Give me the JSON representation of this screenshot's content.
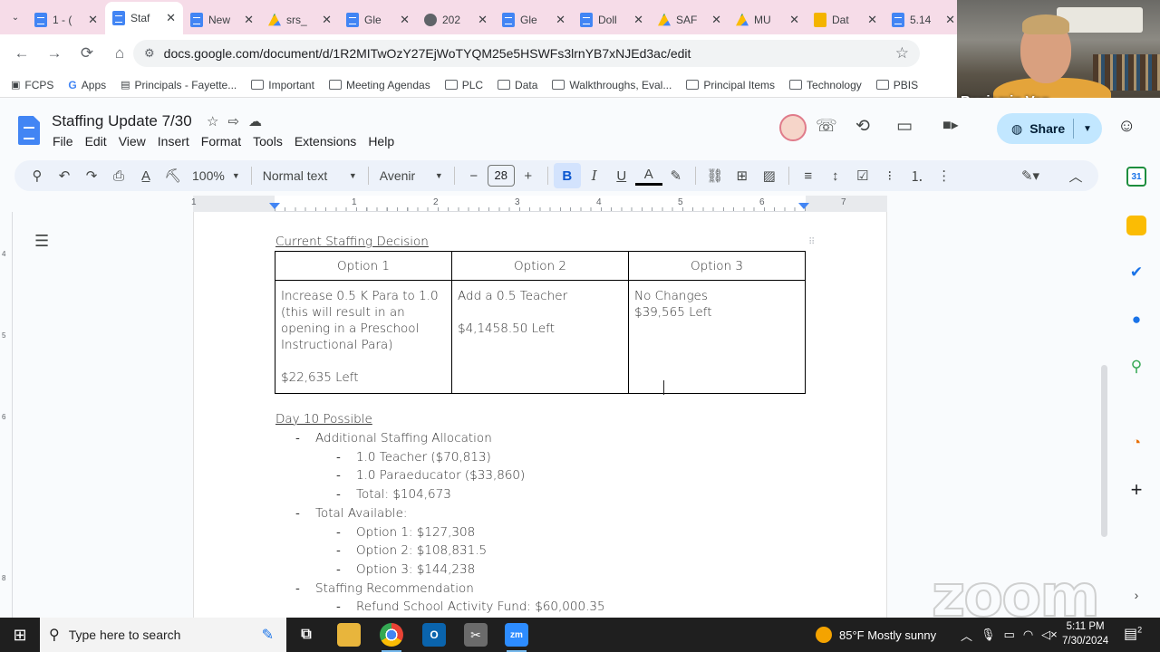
{
  "browser": {
    "tabs": [
      {
        "label": "1 - (",
        "icon": "docs-icon"
      },
      {
        "label": "Staf",
        "icon": "docs-icon",
        "active": true
      },
      {
        "label": "New",
        "icon": "docs-icon"
      },
      {
        "label": "srs_",
        "icon": "drive-icon"
      },
      {
        "label": "Gle",
        "icon": "docs-icon"
      },
      {
        "label": "202",
        "icon": "globe-icon"
      },
      {
        "label": "Gle",
        "icon": "docs-icon"
      },
      {
        "label": "Doll",
        "icon": "docs-icon"
      },
      {
        "label": "SAF",
        "icon": "drive-icon"
      },
      {
        "label": "MU",
        "icon": "drive-icon"
      },
      {
        "label": "Dat",
        "icon": "slides-icon"
      },
      {
        "label": "5.14",
        "icon": "docs-icon"
      }
    ],
    "url": "docs.google.com/document/d/1R2MITwOzY27EjWoTYQM25e5HSWFs3lrnYB7xNJEd3ac/edit",
    "bookmarks": [
      "FCPS",
      "Apps",
      "Principals - Fayette...",
      "Important",
      "Meeting Agendas",
      "PLC",
      "Data",
      "Walkthroughs, Eval...",
      "Principal Items",
      "Technology",
      "PBIS"
    ]
  },
  "webcam": {
    "name": "Benjamin Van..."
  },
  "docs": {
    "title": "Staffing Update 7/30",
    "menu": [
      "File",
      "Edit",
      "View",
      "Insert",
      "Format",
      "Tools",
      "Extensions",
      "Help"
    ],
    "share_label": "Share",
    "toolbar": {
      "zoom": "100%",
      "style": "Normal text",
      "font": "Avenir",
      "font_size": "28"
    },
    "ruler_numbers": [
      "1",
      "1",
      "2",
      "3",
      "4",
      "5",
      "6",
      "7"
    ],
    "vruler_numbers": [
      "4",
      "5",
      "6",
      "8"
    ]
  },
  "document": {
    "heading1": "Current Staffing Decision",
    "table": {
      "headers": [
        "Option 1",
        "Option 2",
        "Option 3"
      ],
      "cells": [
        "Increase 0.5 K Para to 1.0\n(this will result in an\nopening in a Preschool\nInstructional Para)\n\n$22,635 Left",
        "Add a 0.5 Teacher\n\n$4,1458.50 Left",
        "No Changes\n$39,565 Left"
      ]
    },
    "heading2": "Day 10 Possible",
    "bullet_marker": "-",
    "list": [
      {
        "text": "Additional Staffing Allocation",
        "level": 1
      },
      {
        "text": "1.0 Teacher ($70,813)",
        "level": 2
      },
      {
        "text": "1.0 Paraeducator ($33,860)",
        "level": 2
      },
      {
        "text": "Total: $104,673",
        "level": 2
      },
      {
        "text": "Total Available:",
        "level": 1
      },
      {
        "text": "Option 1: $127,308",
        "level": 2
      },
      {
        "text": "Option 2: $108,831.5",
        "level": 2
      },
      {
        "text": "Option 3: $144,238",
        "level": 2
      },
      {
        "text": "Staffing Recommendation",
        "level": 1
      },
      {
        "text": "Refund School Activity Fund: $60,000.35",
        "level": 2
      }
    ]
  },
  "watermark": "zoom",
  "taskbar": {
    "search_placeholder": "Type here to search",
    "weather": "85°F  Mostly sunny",
    "time": "5:11 PM",
    "date": "7/30/2024",
    "notifications": "2"
  }
}
